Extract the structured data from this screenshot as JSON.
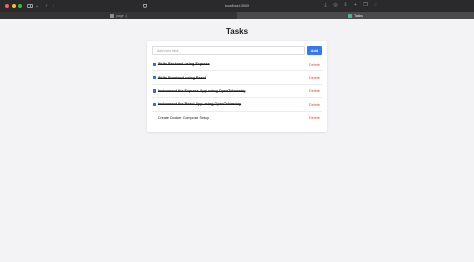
{
  "browser": {
    "url": "localhost:3000",
    "tabs": [
      {
        "label": "page :)",
        "active": false
      },
      {
        "label": "Tasks",
        "active": true
      }
    ]
  },
  "app": {
    "title": "Tasks",
    "input": {
      "value": "",
      "placeholder": "Add new task"
    },
    "add_label": "Add",
    "delete_label": "Delete",
    "tasks": [
      {
        "text": "Write Backend using Express",
        "done": true
      },
      {
        "text": "Write Frontend using React",
        "done": true
      },
      {
        "text": "Instrument the Express App using OpenTelemetry",
        "done": true
      },
      {
        "text": "Instrument the React App using OpenTelemetry",
        "done": true
      },
      {
        "text": "Create Docker Compose Setup",
        "done": false
      }
    ]
  },
  "colors": {
    "accent": "#3478f6",
    "delete": "#e8453c",
    "background": "#f3f3f5"
  }
}
